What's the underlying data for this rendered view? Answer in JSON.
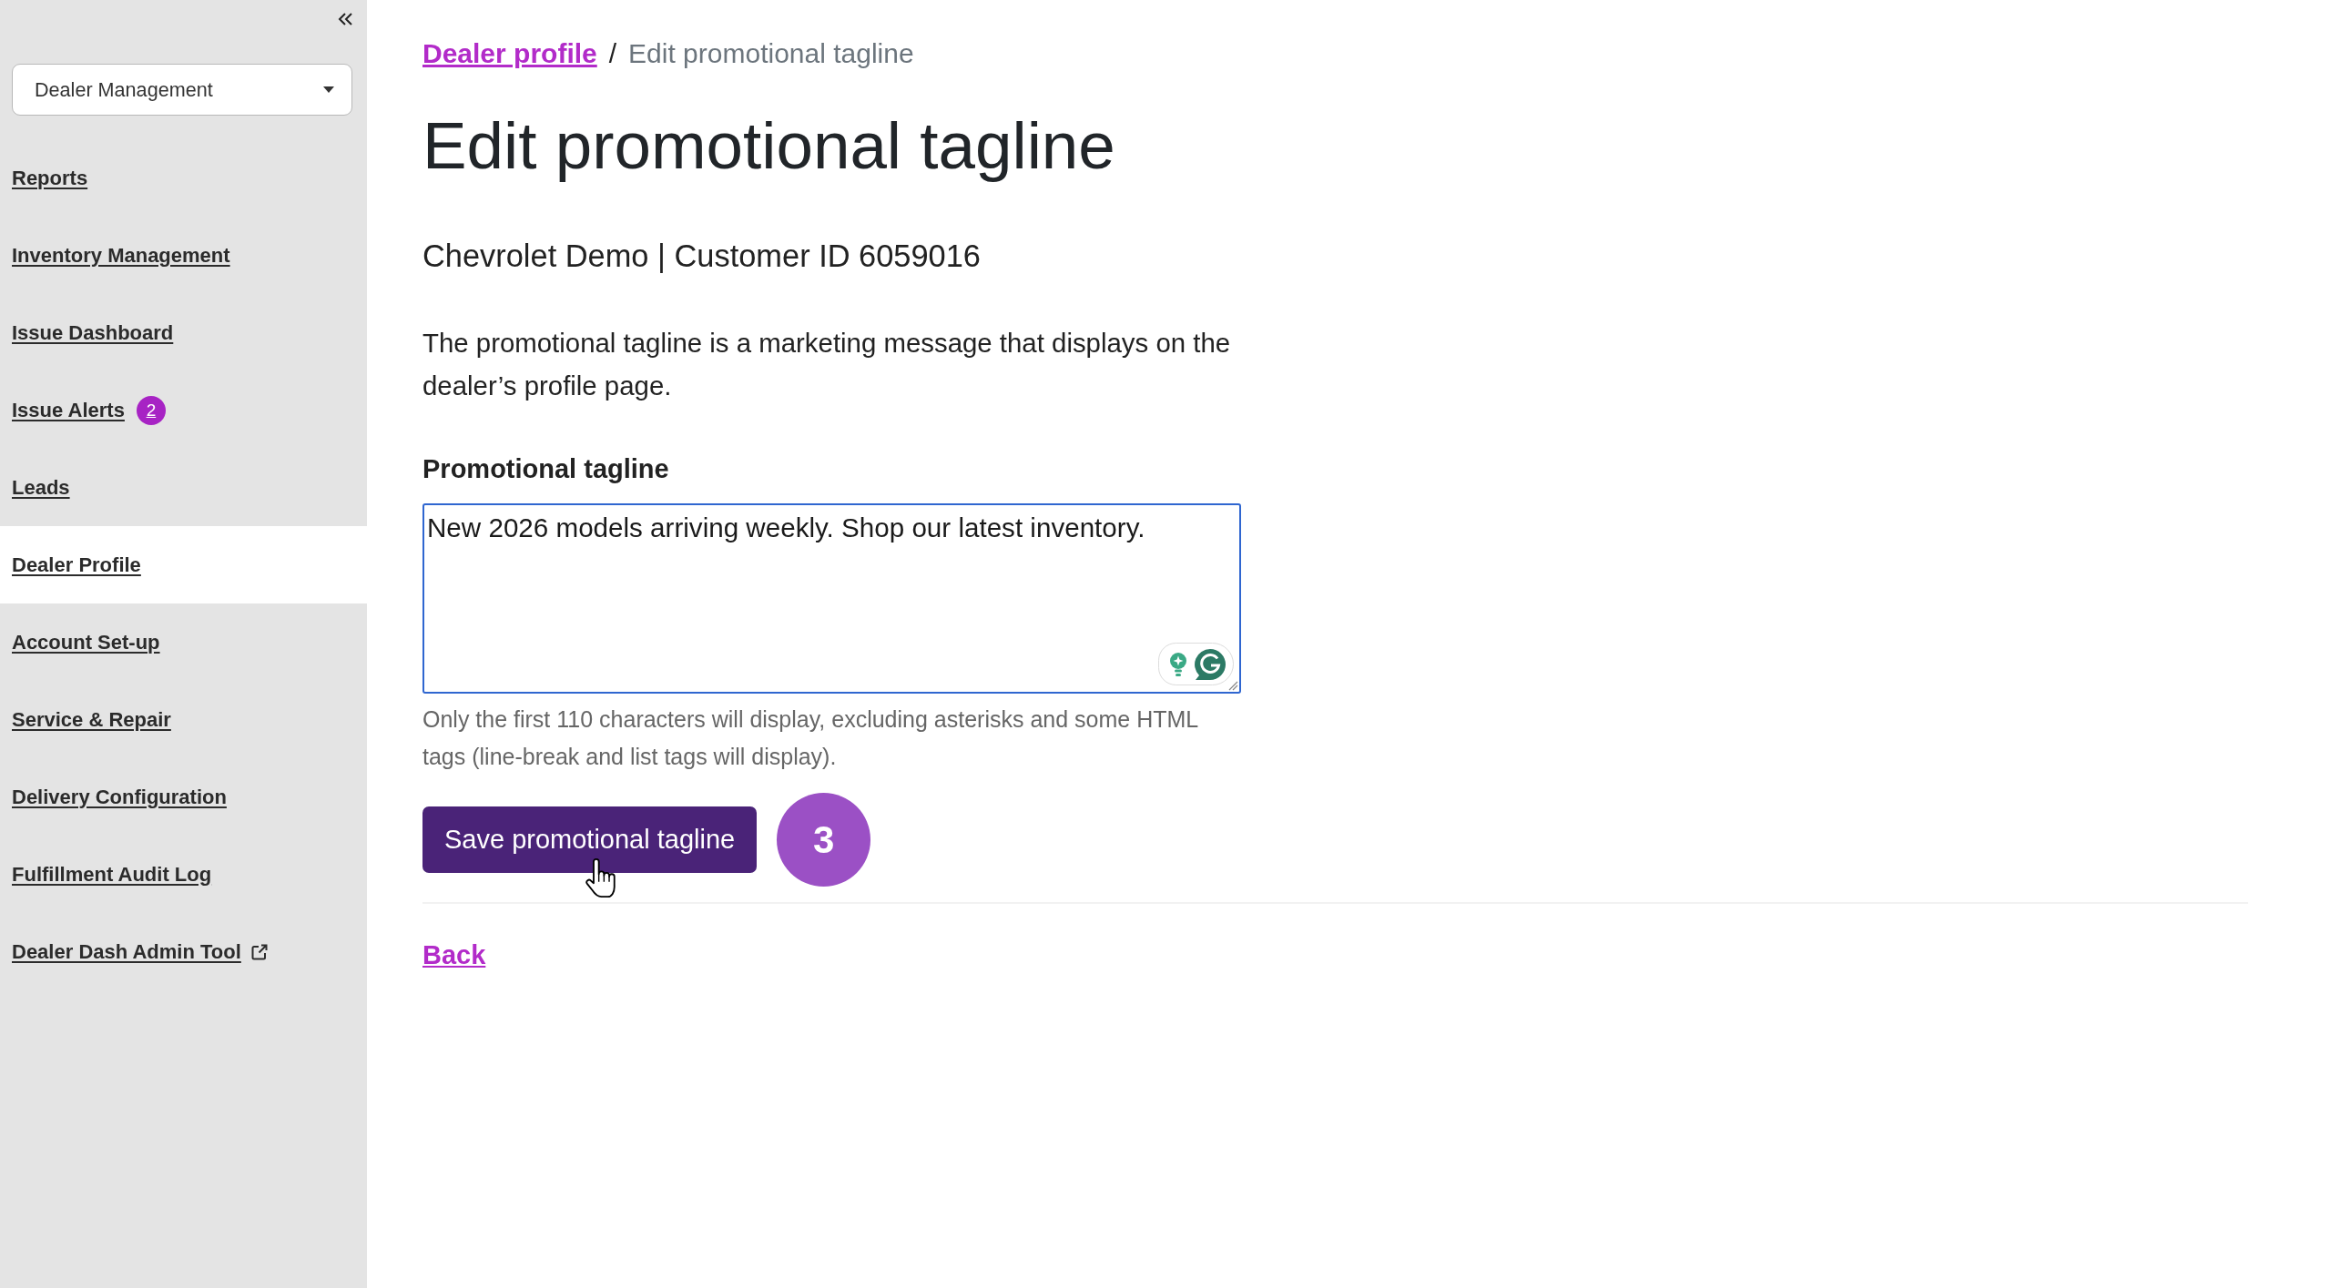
{
  "sidebar": {
    "dropdown": {
      "value": "Dealer Management"
    },
    "items": [
      {
        "label": "Reports",
        "selected": false,
        "external": false
      },
      {
        "label": "Inventory Management",
        "selected": false,
        "external": false
      },
      {
        "label": "Issue Dashboard",
        "selected": false,
        "external": false
      },
      {
        "label": "Issue Alerts",
        "selected": false,
        "external": false,
        "badge": "2"
      },
      {
        "label": "Leads",
        "selected": false,
        "external": false
      },
      {
        "label": "Dealer Profile",
        "selected": true,
        "external": false
      },
      {
        "label": "Account Set-up",
        "selected": false,
        "external": false
      },
      {
        "label": "Service & Repair",
        "selected": false,
        "external": false
      },
      {
        "label": "Delivery Configuration",
        "selected": false,
        "external": false
      },
      {
        "label": "Fulfillment Audit Log",
        "selected": false,
        "external": false
      },
      {
        "label": "Dealer Dash Admin Tool",
        "selected": false,
        "external": true
      }
    ]
  },
  "breadcrumb": {
    "items": [
      {
        "label": "Dealer profile",
        "kind": "link"
      },
      {
        "label": "Edit promotional tagline",
        "kind": "current"
      }
    ],
    "separator": "/"
  },
  "title": "Edit promotional tagline",
  "customer_info": "Chevrolet Demo | Customer ID 6059016",
  "description": "The promotional tagline is a marketing message that displays on the dealer’s profile page.",
  "field": {
    "label": "Promotional tagline",
    "value": "New 2026 models arriving weekly. Shop our latest inventory.",
    "focused": true
  },
  "help_text": "Only the first 110 characters will display, excluding asterisks and some HTML tags (line-break and list tags will display).",
  "save_button": "Save promotional tagline",
  "step_marker": "3",
  "back_link": "Back"
}
